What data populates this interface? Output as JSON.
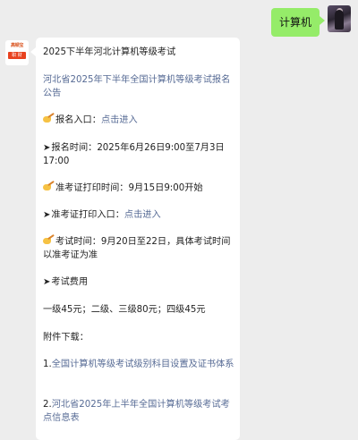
{
  "user_message": "计算机",
  "bot_logo": {
    "top": "高顿宝",
    "bottom": "职 财"
  },
  "post": {
    "title": "2025下半年河北计算机等级考试",
    "announcement_link": "河北省2025年下半年全国计算机等级考试报名公告",
    "reg_entry_label": "报名入口：",
    "reg_entry_link": "点击进入",
    "reg_time": "报名时间：2025年6月26日9:00至7月3日17:00",
    "admit_print_time": "准考证打印时间：9月15日9:00开始",
    "admit_entry_label": "准考证打印入口：",
    "admit_entry_link": "点击进入",
    "exam_time": "考试时间：9月20日至22日，具体考试时间以准考证为准",
    "fee_heading": "考试费用",
    "fee_detail": "一级45元；二级、三级80元；四级45元",
    "attach_heading": "附件下载：",
    "attach_1_prefix": "1.",
    "attach_1_link": "全国计算机等级考试级别科目设置及证书体系",
    "attach_2_prefix": "2.",
    "attach_2_link": "河北省2025年上半年全国计算机等级考试考点信息表"
  }
}
